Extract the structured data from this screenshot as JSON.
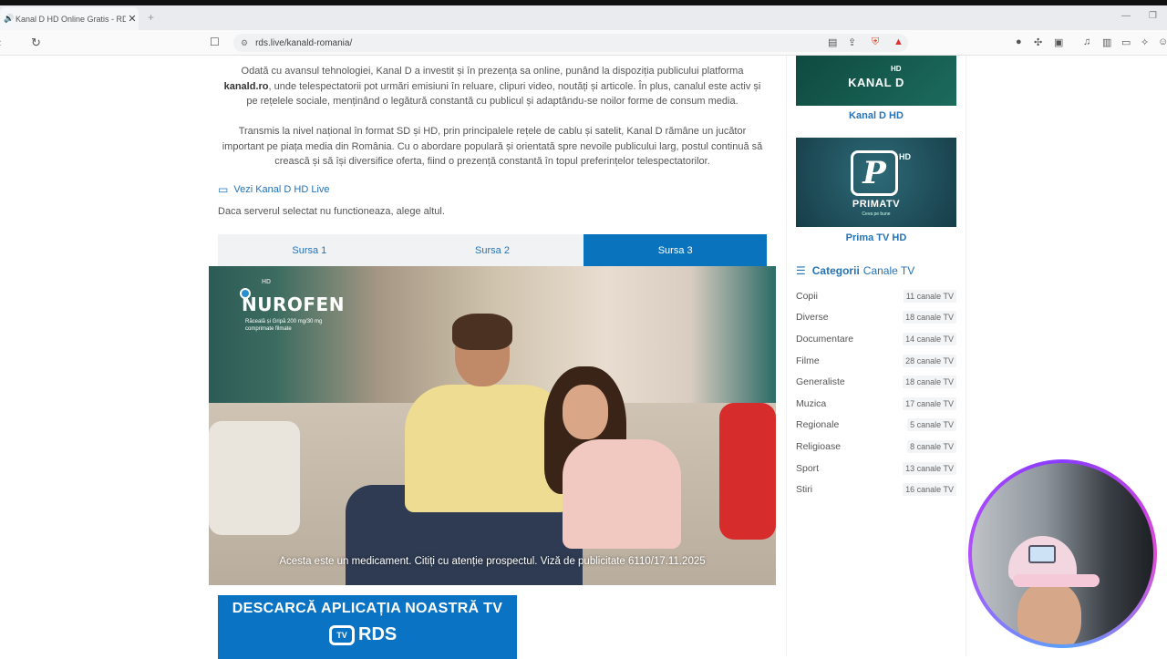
{
  "browser": {
    "tab_title": "Kanal D HD Online Gratis - RD",
    "url": "rds.live/kanald-romania/"
  },
  "article": {
    "para1_a": "Odată cu avansul tehnologiei, Kanal D a investit și în prezența sa online, punând la dispoziția publicului platforma ",
    "para1_bold": "kanald.ro",
    "para1_b": ", unde telespectatorii pot urmări emisiuni în reluare, clipuri video, noutăți și articole. În plus, canalul este activ și pe rețelele sociale, menținând o legătură constantă cu publicul și adaptându-se noilor forme de consum media.",
    "para2": "Transmis la nivel național în format SD și HD, prin principalele rețele de cablu și satelit, Kanal D rămâne un jucător important pe piața media din România. Cu o abordare populară și orientată spre nevoile publicului larg, postul continuă să crească și să își diversifice oferta, fiind o prezență constantă în topul preferințelor telespectatorilor.",
    "live_link": "Vezi Kanal D HD Live",
    "server_note": "Daca serverul selectat nu functioneaza, alege altul."
  },
  "sources": [
    "Sursa 1",
    "Sursa 2",
    "Sursa 3"
  ],
  "active_source": "Sursa 3",
  "player": {
    "ad_brand": "NUROFEN",
    "ad_sub_line1": "Răceală și Gripă 200 mg/30 mg",
    "ad_sub_line2": "comprimate filmate",
    "channel_hd": "HD",
    "caption": "Acesta este un medicament. Citiți cu atenție prospectul. Viză de publicitate 6110/17.11.2025"
  },
  "banner": {
    "title": "DESCARCĂ APLICAȚIA NOASTRĂ TV",
    "logo": "RDS",
    "tv_glyph": "TV"
  },
  "sidebar": {
    "channel1_name": "Kanal D HD",
    "channel1_logo": "KANAL D",
    "channel1_hd": "HD",
    "channel2_name": "Prima TV HD",
    "channel2_logo": "PRIMATV",
    "channel2_mark": "P",
    "channel2_hd": "HD",
    "channel2_tagline": "Ceva pe bune",
    "categories_title_a": "Categorii",
    "categories_title_b": "Canale TV",
    "categories": [
      {
        "name": "Copii",
        "count": "11 canale TV"
      },
      {
        "name": "Diverse",
        "count": "18 canale TV"
      },
      {
        "name": "Documentare",
        "count": "14 canale TV"
      },
      {
        "name": "Filme",
        "count": "28 canale TV"
      },
      {
        "name": "Generaliste",
        "count": "18 canale TV"
      },
      {
        "name": "Muzica",
        "count": "17 canale TV"
      },
      {
        "name": "Regionale",
        "count": "5 canale TV"
      },
      {
        "name": "Religioase",
        "count": "8 canale TV"
      },
      {
        "name": "Sport",
        "count": "13 canale TV"
      },
      {
        "name": "Stiri",
        "count": "16 canale TV"
      }
    ]
  },
  "colors": {
    "accent": "#2573b5",
    "active_source_bg": "#0a73bd",
    "banner_bg": "#0b73c4"
  },
  "icons": {
    "back": "arrow-left-icon",
    "reload": "reload-icon",
    "bookmark": "bookmark-icon",
    "site": "site-info-icon",
    "live": "monitor-icon",
    "categories": "list-icon"
  }
}
